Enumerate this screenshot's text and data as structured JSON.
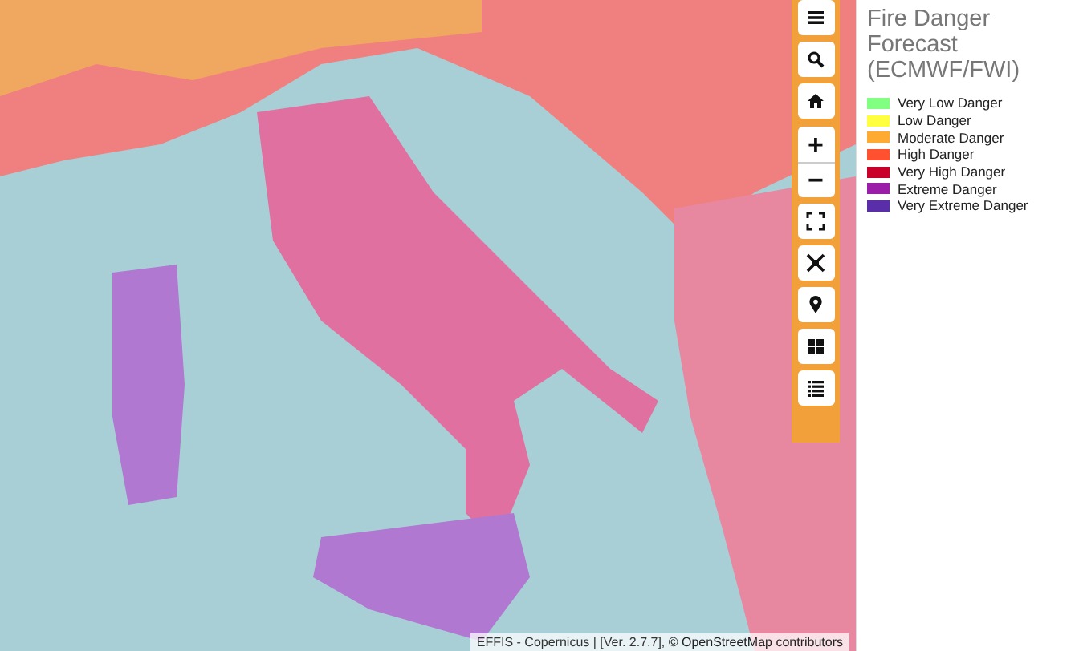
{
  "map": {
    "toolbar": [
      {
        "kind": "menu"
      },
      {
        "kind": "search"
      },
      {
        "kind": "home"
      },
      {
        "kind": "zoom",
        "label": "+"
      },
      {
        "kind": "zoom",
        "label": "−"
      },
      {
        "kind": "fullscreen"
      },
      {
        "kind": "fit"
      },
      {
        "kind": "location"
      },
      {
        "kind": "grid"
      },
      {
        "kind": "list"
      }
    ],
    "attribution": {
      "text": "EFFIS - Copernicus | [Ver. 2.7.7], ",
      "link": "© OpenStreetMap contributors"
    }
  },
  "legend": {
    "title": "Fire Danger Forecast (ECMWF/FWI)",
    "items": [
      {
        "label": "Very Low Danger",
        "color": "#80ff80"
      },
      {
        "label": "Low Danger",
        "color": "#ffff40"
      },
      {
        "label": "Moderate Danger",
        "color": "#ffaa33"
      },
      {
        "label": "High Danger",
        "color": "#ff5030"
      },
      {
        "label": "Very High Danger",
        "color": "#c8002a"
      },
      {
        "label": "Extreme Danger",
        "color": "#9a1ea8"
      },
      {
        "label": "Very Extreme Danger",
        "color": "#5a2ea8"
      }
    ]
  }
}
